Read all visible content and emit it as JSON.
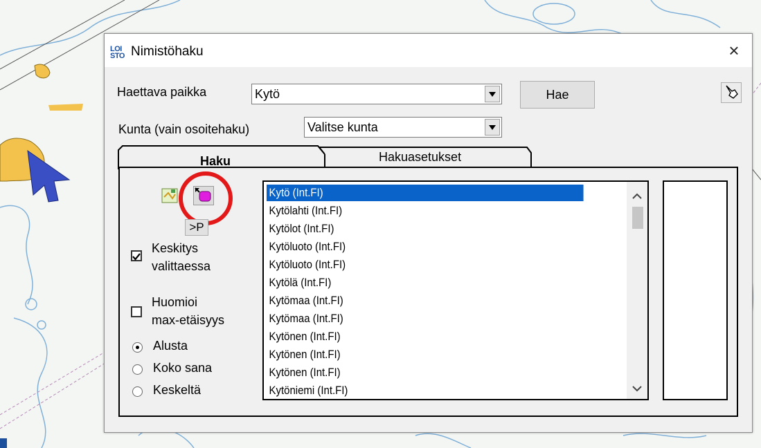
{
  "dialog": {
    "logo_text": "LOI STO",
    "title": "Nimistöhaku",
    "close_label": "×"
  },
  "search": {
    "place_label": "Haettava paikka",
    "place_value": "Kytö",
    "search_button": "Hae",
    "municipality_label": "Kunta (vain osoitehaku)",
    "municipality_value": "Valitse kunta"
  },
  "tabs": [
    {
      "label": "Haku",
      "active": true
    },
    {
      "label": "Hakuasetukset",
      "active": false
    }
  ],
  "tools": {
    "next_button": ">P",
    "center_on_select": {
      "label_line1": "Keskitys",
      "label_line2": "valittaessa",
      "checked": true
    },
    "max_distance": {
      "label_line1": "Huomioi",
      "label_line2": "max-etäisyys",
      "checked": false
    },
    "match_options": [
      {
        "label": "Alusta",
        "selected": true
      },
      {
        "label": "Koko sana",
        "selected": false
      },
      {
        "label": "Keskeltä",
        "selected": false
      }
    ]
  },
  "results": [
    "Kytö (Int.FI)",
    "Kytölahti (Int.FI)",
    "Kytölot (Int.FI)",
    "Kytöluoto (Int.FI)",
    "Kytöluoto (Int.FI)",
    "Kytölä (Int.FI)",
    "Kytömaa (Int.FI)",
    "Kytömaa (Int.FI)",
    "Kytönen (Int.FI)",
    "Kytönen (Int.FI)",
    "Kytönen (Int.FI)",
    "Kytöniemi (Int.FI)"
  ],
  "selected_result_index": 0,
  "colors": {
    "selection": "#0a63c9",
    "highlight_circle": "#e31919",
    "map_background": "#f4f6f4",
    "map_land": "#f3c24c",
    "map_water_lines": "#7fb0d8"
  }
}
